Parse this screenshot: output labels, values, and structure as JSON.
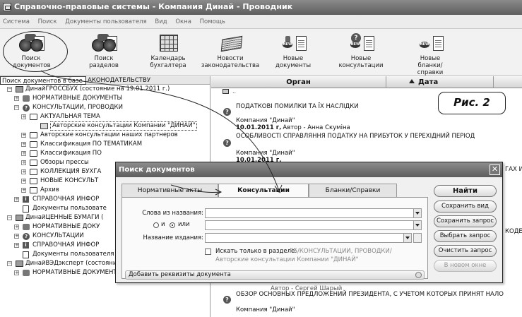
{
  "window": {
    "title": "Справочно-правовые системы - Компания Динай - Проводник"
  },
  "menu": [
    "Система",
    "Поиск",
    "Документы пользователя",
    "Вид",
    "Окна",
    "Помощь"
  ],
  "toolbar": {
    "search_docs": "Поиск документов",
    "search_sections": "Поиск разделов",
    "calendar": "Календарь бухгалтера",
    "news": "Новости законодательства",
    "new_docs": "Новые документы",
    "new_consult": "Новые консультации",
    "new_forms": "Новые бланки/справки"
  },
  "left": {
    "header_selected": "Поиск документов в базе",
    "header_rest": "АКОНОДАТЕЛЬСТВУ",
    "tree": [
      "ДинайГРОССБУХ (состояние на 19.01.2011 г.)",
      "НОРМАТИВНЫЕ ДОКУМЕНТЫ",
      "КОНСУЛЬТАЦИИ, ПРОВОДКИ",
      "АКТУАЛЬНАЯ ТЕМА",
      "Авторские консультации Компании \"ДИНАЙ\"",
      "Авторские консультации наших партнеров",
      "Классификация ПО ТЕМАТИКАМ",
      "Классификация ПО",
      "Обзоры прессы",
      "КОЛЛЕКЦИЯ БУХГА",
      "НОВЫЕ КОНСУЛЬТ",
      "Архив",
      "СПРАВОЧНАЯ ИНФОР",
      "Документы пользовате",
      "ДинайЦЕННЫЕ БУМАГИ (",
      "НОРМАТИВНЫЕ ДОКУ",
      "КОНСУЛЬТАЦИИ",
      "СПРАВОЧНАЯ ИНФОР",
      "Документы пользователя",
      "ДинайВЭДэксперт (состояние на 19.01.2011 г.)",
      "НОРМАТИВНЫЕ ДОКУМЕНТЫ"
    ]
  },
  "grid": {
    "col_organ": "Орган",
    "col_date": "Дата",
    "top_row": "..",
    "entries": [
      {
        "title": "ПОДАТКОВІ ПОМИЛКИ ТА ЇХ НАСЛІДКИ",
        "org": "Компания \"Динай\"",
        "date": "10.01.2011 г.",
        "author": ", Автор - Анна Скуміна"
      },
      {
        "title": "ОСОБЛИВОСТІ СПРАВЛЯННЯ ПОДАТКУ НА ПРИБУТОК У ПЕРЕХІДНИЙ ПЕРІОД",
        "org": "Компания \"Динай\"",
        "date": "10.01.2011 г.",
        "author": ""
      }
    ],
    "partial_right_1": "ГАХ И",
    "partial_right_2": "КОДЕ",
    "bottom_author": "Автор - Сергей Шарый",
    "bottom_title": "ОБЗОР ОСНОВНЫХ ПРЕДЛОЖЕНИЙ ПРЕЗИДЕНТА, С УЧЕТОМ КОТОРЫХ ПРИНЯТ НАЛО",
    "bottom_org": "Компания \"Динай\""
  },
  "caption": "Рис. 2",
  "dialog": {
    "title": "Поиск документов",
    "tabs": [
      "Нормативные акты",
      "Консультации",
      "Бланки/Справки"
    ],
    "words_label": "Слова из названия:",
    "radio_and": "и",
    "radio_or": "или",
    "edition_label": "Название издания:",
    "words_value": "",
    "edition_value": "",
    "checkbox_label": "Искать только в разделе:",
    "section_path": "ГБ/КОНСУЛЬТАЦИИ, ПРОВОДКИ/",
    "section_path2": "Авторские консультации Компании \"ДИНАЙ\"",
    "add_requisites": "Добавить реквизиты документа",
    "buttons": [
      "Найти",
      "Сохранить вид",
      "Сохранить запрос",
      "Выбрать запрос",
      "Очистить запрос",
      "В новом окне"
    ]
  }
}
